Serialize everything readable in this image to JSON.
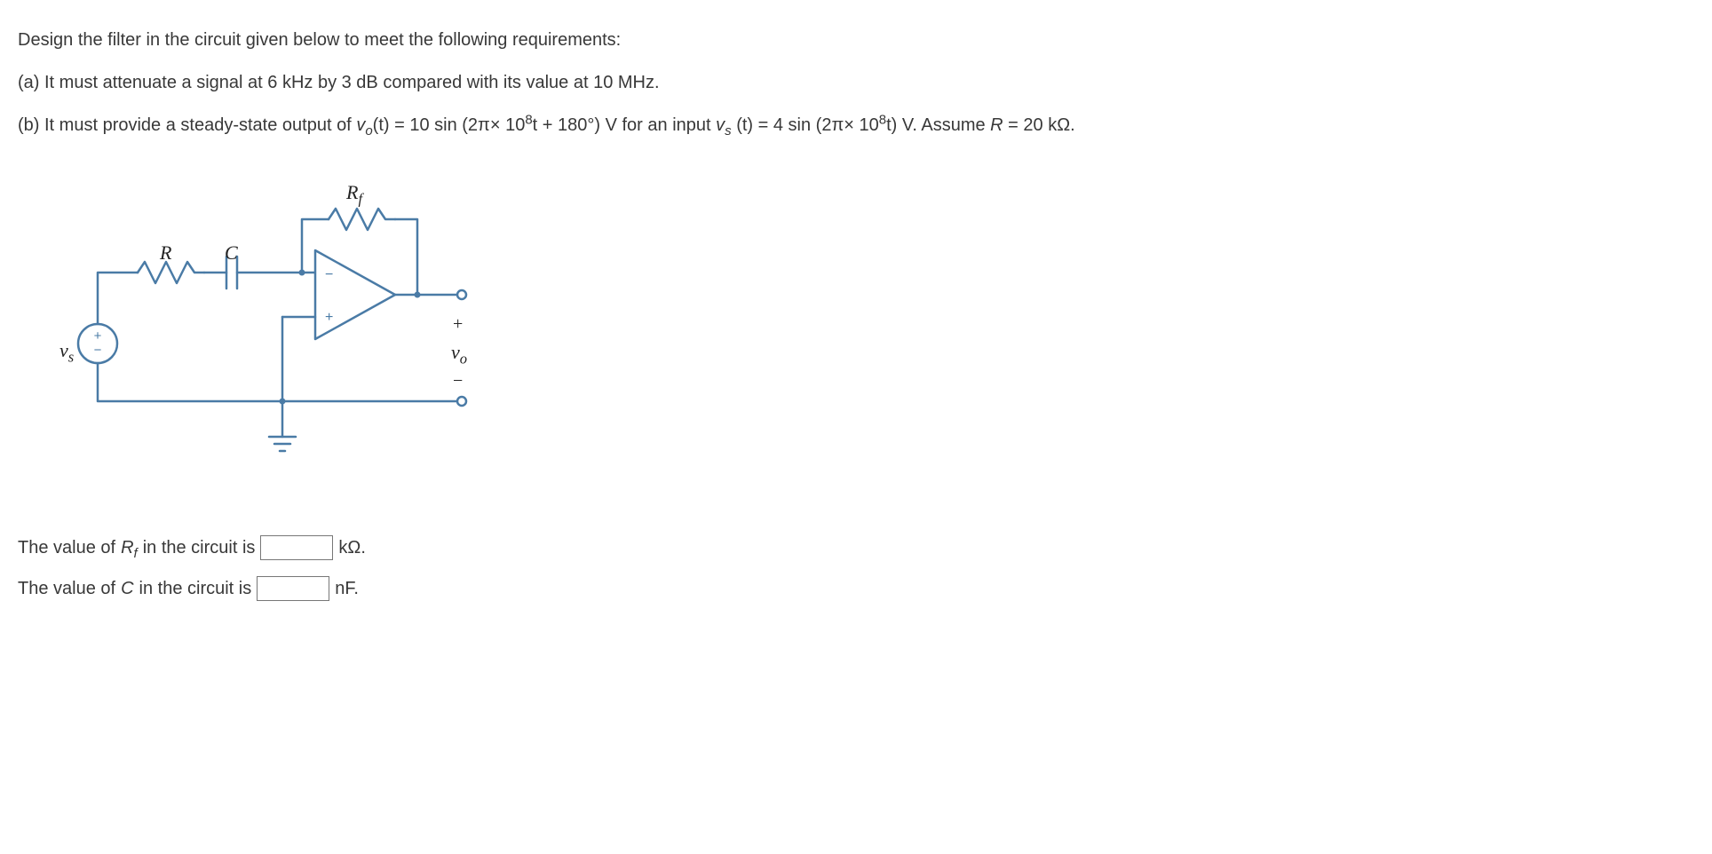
{
  "intro": "Design the filter in the circuit given below to meet the following requirements:",
  "partA": "(a) It must attenuate a signal at 6 kHz by 3 dB compared with its value at 10 MHz.",
  "partB": {
    "prefix": "(b) It must provide a steady-state output of ",
    "vo": "v",
    "voSubO": "o",
    "voArg": "(t) = 10 sin (2π× 10",
    "sup8a": "8",
    "afterSup1": "t + 180°) V for an input ",
    "vs": "v",
    "vsSubS": "s",
    "vsArg": " (t) = 4 sin (2π× 10",
    "sup8b": "8",
    "afterSup2": "t) V. Assume ",
    "rVar": "R",
    "rVal": " = 20 kΩ."
  },
  "labels": {
    "Rf": "R",
    "RfSub": "f",
    "R": "R",
    "C": "C",
    "vs": "v",
    "vsSub": "s",
    "vo": "v",
    "voSub": "o",
    "plus": "+",
    "minus": "−",
    "plusSmall": "+",
    "minusSmall": "−"
  },
  "answers": {
    "rf": {
      "pre": "The value of ",
      "var": "R",
      "varSub": "f",
      "post": " in the circuit is ",
      "unit": " kΩ."
    },
    "c": {
      "pre": "The value of ",
      "var": "C",
      "post": " in the circuit is ",
      "unit": " nF."
    }
  }
}
